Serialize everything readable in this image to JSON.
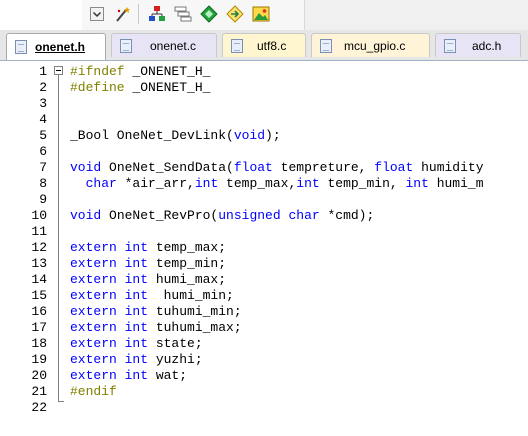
{
  "toolbar": {
    "icons": [
      "dropdown-arrow-icon",
      "magic-wand-icon",
      "flowchart-icon",
      "stack-windows-icon",
      "green-diamond-icon",
      "diamond-arrow-icon",
      "picture-icon"
    ]
  },
  "tabs": [
    {
      "label": "onenet.h",
      "active": true
    },
    {
      "label": "onenet.c",
      "active": false
    },
    {
      "label": "utf8.c",
      "active": false
    },
    {
      "label": "mcu_gpio.c",
      "active": false
    },
    {
      "label": "adc.h",
      "active": false
    }
  ],
  "editor": {
    "lines": [
      {
        "n": "1",
        "tokens": [
          {
            "t": "#ifndef",
            "c": "pp"
          },
          {
            "t": " _ONENET_H_",
            "c": ""
          }
        ]
      },
      {
        "n": "2",
        "tokens": [
          {
            "t": "#define",
            "c": "pp"
          },
          {
            "t": " _ONENET_H_",
            "c": ""
          }
        ]
      },
      {
        "n": "3",
        "tokens": []
      },
      {
        "n": "4",
        "tokens": []
      },
      {
        "n": "5",
        "tokens": [
          {
            "t": "_Bool OneNet_DevLink(",
            "c": ""
          },
          {
            "t": "void",
            "c": "kw"
          },
          {
            "t": ");",
            "c": ""
          }
        ]
      },
      {
        "n": "6",
        "tokens": []
      },
      {
        "n": "7",
        "tokens": [
          {
            "t": "void",
            "c": "kw"
          },
          {
            "t": " OneNet_SendData(",
            "c": ""
          },
          {
            "t": "float",
            "c": "kw"
          },
          {
            "t": " tempreture, ",
            "c": ""
          },
          {
            "t": "float",
            "c": "kw"
          },
          {
            "t": " humidity",
            "c": ""
          }
        ]
      },
      {
        "n": "8",
        "tokens": [
          {
            "t": "  ",
            "c": ""
          },
          {
            "t": "char",
            "c": "kw"
          },
          {
            "t": " *air_arr,",
            "c": ""
          },
          {
            "t": "int",
            "c": "kw"
          },
          {
            "t": " temp_max,",
            "c": ""
          },
          {
            "t": "int",
            "c": "kw"
          },
          {
            "t": " temp_min, ",
            "c": ""
          },
          {
            "t": "int",
            "c": "kw"
          },
          {
            "t": " humi_m",
            "c": ""
          }
        ]
      },
      {
        "n": "9",
        "tokens": []
      },
      {
        "n": "10",
        "tokens": [
          {
            "t": "void",
            "c": "kw"
          },
          {
            "t": " OneNet_RevPro(",
            "c": ""
          },
          {
            "t": "unsigned char",
            "c": "kw"
          },
          {
            "t": " *cmd);",
            "c": ""
          }
        ]
      },
      {
        "n": "11",
        "tokens": []
      },
      {
        "n": "12",
        "tokens": [
          {
            "t": "extern int",
            "c": "kw"
          },
          {
            "t": " temp_max;",
            "c": ""
          }
        ]
      },
      {
        "n": "13",
        "tokens": [
          {
            "t": "extern int",
            "c": "kw"
          },
          {
            "t": " temp_min;",
            "c": ""
          }
        ]
      },
      {
        "n": "14",
        "tokens": [
          {
            "t": "extern int",
            "c": "kw"
          },
          {
            "t": " humi_max;",
            "c": ""
          }
        ]
      },
      {
        "n": "15",
        "tokens": [
          {
            "t": "extern int",
            "c": "kw"
          },
          {
            "t": "  humi_min;",
            "c": ""
          }
        ]
      },
      {
        "n": "16",
        "tokens": [
          {
            "t": "extern int",
            "c": "kw"
          },
          {
            "t": " tuhumi_min;",
            "c": ""
          }
        ]
      },
      {
        "n": "17",
        "tokens": [
          {
            "t": "extern int",
            "c": "kw"
          },
          {
            "t": " tuhumi_max;",
            "c": ""
          }
        ]
      },
      {
        "n": "18",
        "tokens": [
          {
            "t": "extern int",
            "c": "kw"
          },
          {
            "t": " state;",
            "c": ""
          }
        ]
      },
      {
        "n": "19",
        "tokens": [
          {
            "t": "extern int",
            "c": "kw"
          },
          {
            "t": " yuzhi;",
            "c": ""
          }
        ]
      },
      {
        "n": "20",
        "tokens": [
          {
            "t": "extern int",
            "c": "kw"
          },
          {
            "t": " wat;",
            "c": ""
          }
        ]
      },
      {
        "n": "21",
        "tokens": [
          {
            "t": "#endif",
            "c": "pp"
          }
        ]
      },
      {
        "n": "22",
        "tokens": []
      }
    ]
  },
  "colors": {
    "keyword": "#0000ff",
    "preprocessor": "#808000",
    "text": "#000000"
  }
}
